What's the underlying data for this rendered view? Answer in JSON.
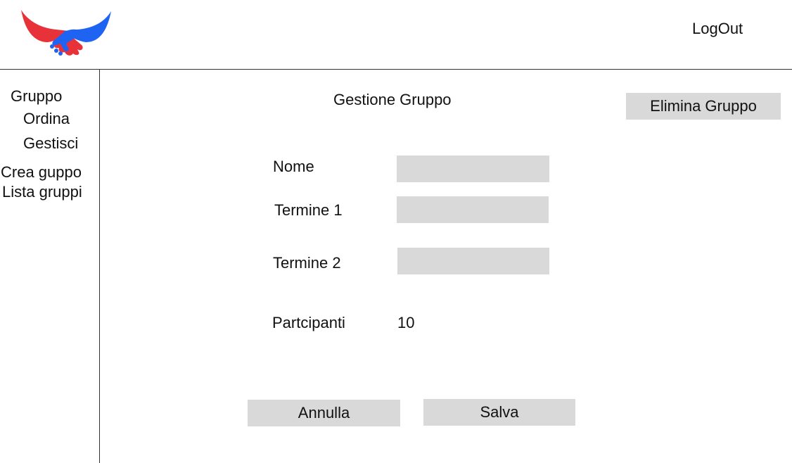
{
  "header": {
    "logo_icon": "handshake-logo-icon",
    "logout_label": "LogOut"
  },
  "sidebar": {
    "section_title": "Gruppo",
    "items": [
      {
        "label": "Ordina"
      },
      {
        "label": "Gestisci"
      },
      {
        "label": "Crea guppo"
      },
      {
        "label": "Lista gruppi"
      }
    ]
  },
  "main": {
    "title": "Gestione Gruppo",
    "delete_button_label": "Elimina Gruppo",
    "form": {
      "nome_label": "Nome",
      "nome_value": "",
      "termine1_label": "Termine 1",
      "termine1_value": "",
      "termine2_label": "Termine 2",
      "termine2_value": "",
      "participants_label": "Partcipanti",
      "participants_value": "10"
    },
    "cancel_button_label": "Annulla",
    "save_button_label": "Salva"
  },
  "colors": {
    "field_bg": "#d9d9d9",
    "logo_red": "#e8323a",
    "logo_blue": "#1f63f2"
  }
}
